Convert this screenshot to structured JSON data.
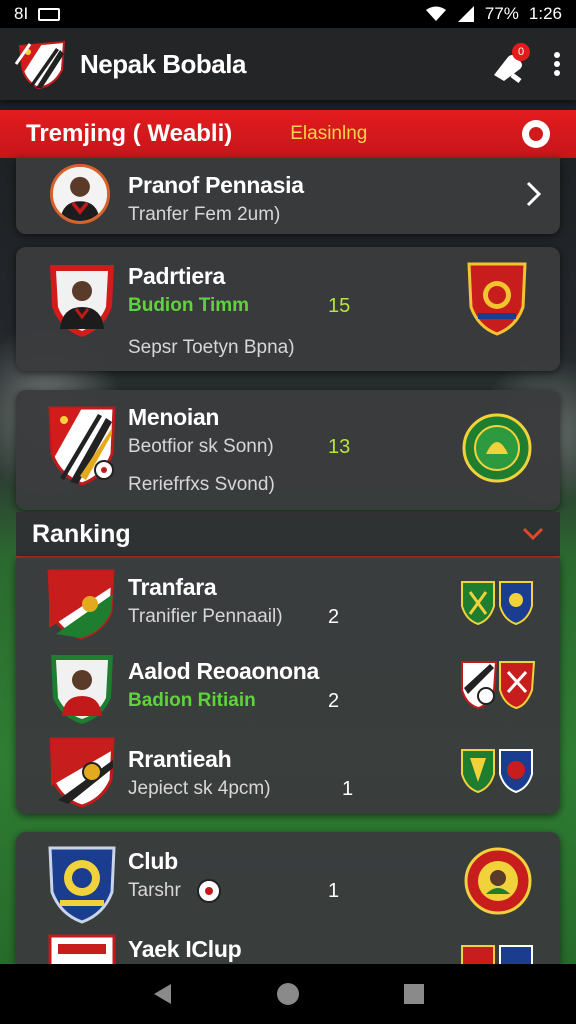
{
  "status_bar": {
    "left_text": "8I",
    "battery_percent": "77%",
    "time": "1:26"
  },
  "app_bar": {
    "title": "Nepak Bobala",
    "notification_count": "0"
  },
  "trending": {
    "title": "Tremjing ( Weabli)",
    "subtitle": "Elasinlng"
  },
  "transfers": [
    {
      "name": "Pranof Pennasia",
      "detail": "Tranfer Fem 2um)"
    },
    {
      "name": "Padrtiera",
      "detail": "Budion Timm",
      "value": "15",
      "extra": "Sepsr Toetyn Bpna)"
    },
    {
      "name": "Menoian",
      "detail": "Beotfior sk Sonn)",
      "value": "13",
      "extra": "Reriefrfxs Svond)"
    }
  ],
  "ranking": {
    "title": "Ranking",
    "items": [
      {
        "name": "Tranfara",
        "detail": "Tranifier Pennaail)",
        "value": "2"
      },
      {
        "name": "Aalod Reoaonona",
        "detail": "Badion Ritiain",
        "value": "2"
      },
      {
        "name": "Rrantieah",
        "detail": "Jepiect sk 4pcm)",
        "value": "1"
      }
    ]
  },
  "clubs": [
    {
      "name": "Club",
      "detail": "Tarshr",
      "value": "1"
    },
    {
      "name": "Yaek IClup"
    }
  ],
  "colors": {
    "accent_red": "#e21c1f",
    "highlight_yellow": "#f7d24a",
    "green_text": "#5fd33b",
    "lime_number": "#b9e537"
  }
}
